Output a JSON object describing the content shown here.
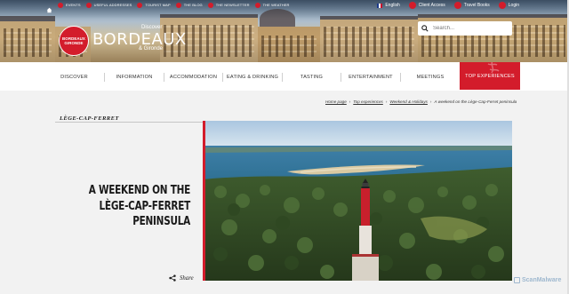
{
  "topbar": {
    "left_items": [
      {
        "label": "EVENTS",
        "icon": "calendar-icon"
      },
      {
        "label": "USEFUL ADDRESSES",
        "icon": "pin-icon"
      },
      {
        "label": "TOURIST MAP",
        "icon": "map-icon"
      },
      {
        "label": "THE BLOG",
        "icon": "blog-icon"
      },
      {
        "label": "THE NEWSLETTER",
        "icon": "mail-icon"
      },
      {
        "label": "THE WEATHER",
        "icon": "weather-icon"
      }
    ],
    "language": "English",
    "client_access": "Client Access",
    "travel_books": "Travel Books",
    "login": "Login"
  },
  "logo": {
    "line1": "BORDEAUX",
    "line2": "GIRONDE",
    "discover": "Discover",
    "title": "BORDEAUX",
    "subtitle": "& Gironde"
  },
  "search": {
    "placeholder": "Search..."
  },
  "nav": {
    "items": [
      "DISCOVER",
      "INFORMATION",
      "ACCOMMODATION",
      "EATING & DRINKING",
      "TASTING",
      "ENTERTAINMENT",
      "MEETINGS"
    ],
    "active": "TOP EXPERIENCES"
  },
  "breadcrumb": {
    "home": "Home page",
    "level1": "Top experiences",
    "level2": "Weekend & Holidays",
    "current": "A weekend on the Lège-Cap-Ferret peninsula"
  },
  "article": {
    "location": "LÈGE-CAP-FERRET",
    "title": "A WEEKEND ON THE LÈGE-CAP-FERRET PENINSULA",
    "share": "Share"
  },
  "watermark": "ScanMalware",
  "colors": {
    "brand_red": "#d31c2b",
    "background": "#f2f2f2"
  }
}
